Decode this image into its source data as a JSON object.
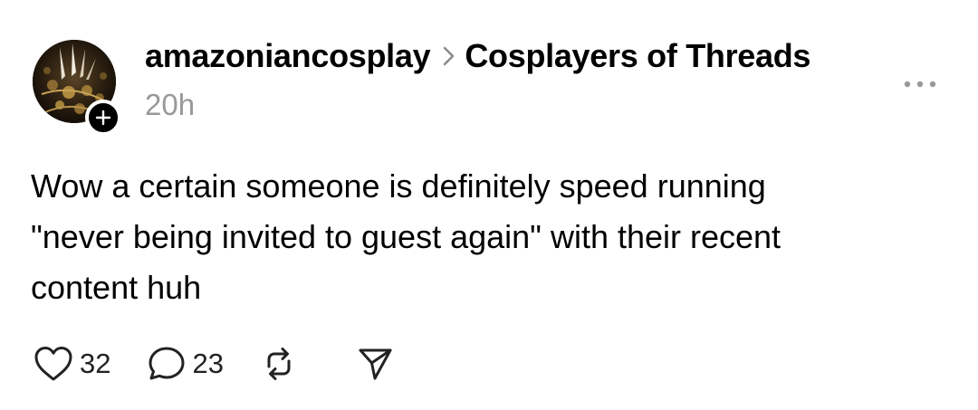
{
  "post": {
    "author": "amazoniancosplay",
    "community": "Cosplayers of Threads",
    "timestamp": "20h",
    "body_lines": [
      "Wow a certain someone is definitely speed running",
      "\"never being invited to guest again\" with their recent",
      "content huh"
    ],
    "like_count": "32",
    "reply_count": "23"
  },
  "icons": {
    "avatar": "profile-photo",
    "follow": "plus-icon",
    "separator": "chevron-right-icon",
    "more": "more-horizontal-icon",
    "like": "heart-icon",
    "reply": "comment-icon",
    "repost": "repost-icon",
    "share": "send-icon"
  },
  "colors": {
    "text": "#000000",
    "muted": "#999999",
    "background": "#ffffff"
  }
}
